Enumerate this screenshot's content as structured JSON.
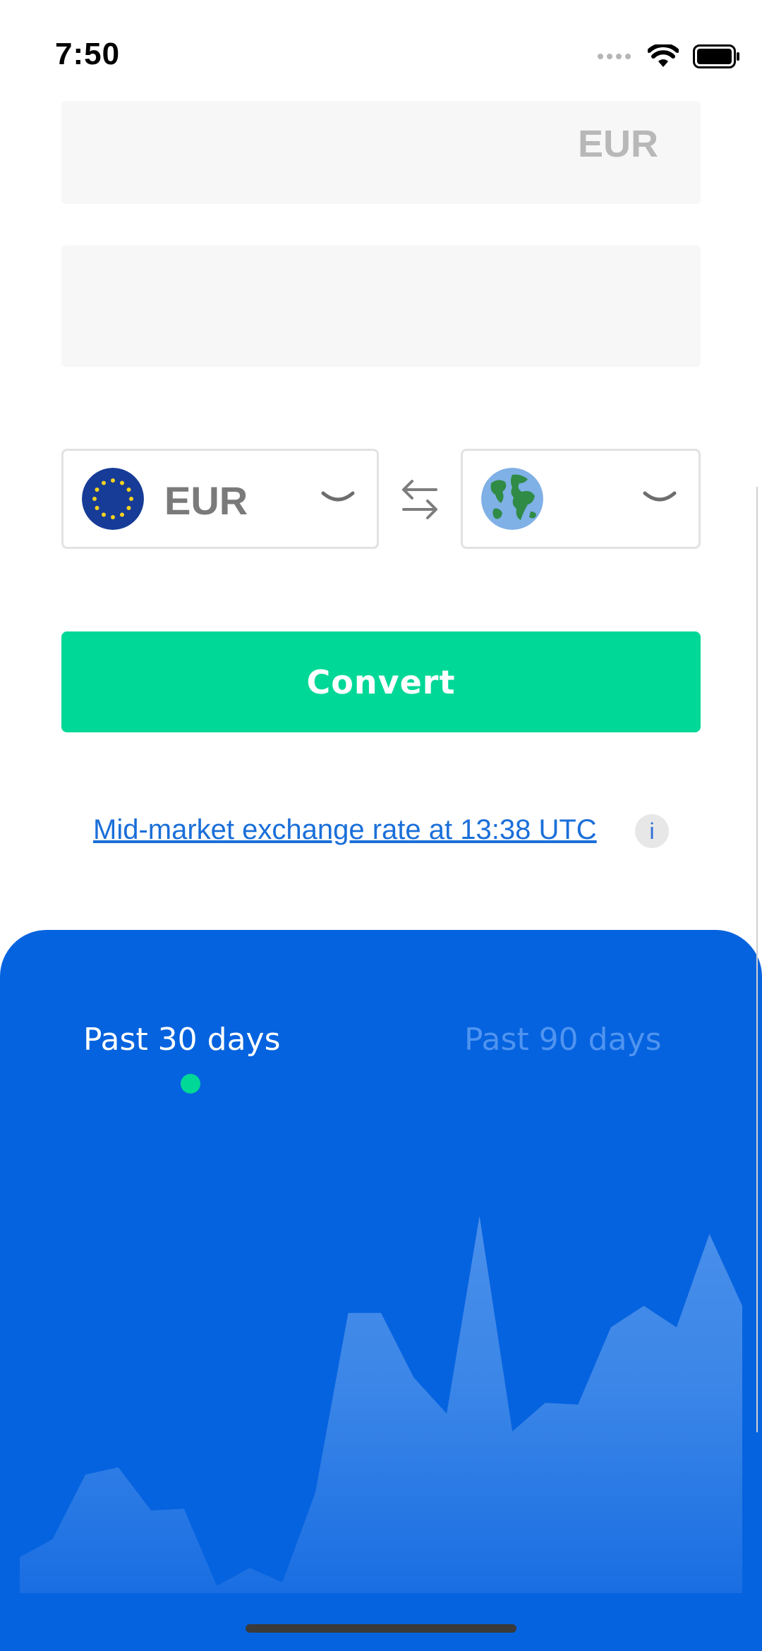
{
  "status_bar": {
    "time": "7:50"
  },
  "converter": {
    "amount_top": {
      "currency": "EUR"
    },
    "from_currency": {
      "code": "EUR",
      "flag_icon": "eu-flag-icon"
    },
    "to_currency": {
      "code": "",
      "flag_icon": "globe-icon"
    },
    "convert_label": "Convert",
    "rate_link": "Mid-market exchange rate at 13:38 UTC",
    "info_label": "i"
  },
  "chart_panel": {
    "tabs": [
      {
        "label": "Past 30 days",
        "active": true
      },
      {
        "label": "Past 90 days",
        "active": false
      }
    ]
  },
  "chart_data": {
    "type": "area",
    "title": "",
    "xlabel": "",
    "ylabel": "",
    "values": [
      1.0,
      1.5,
      3.3,
      3.5,
      2.3,
      2.35,
      0.2,
      0.7,
      0.3,
      2.8,
      7.8,
      7.8,
      6.0,
      5.0,
      10.5,
      4.5,
      5.3,
      5.25,
      7.4,
      8.0,
      7.4,
      10.0,
      8.0
    ],
    "ylim": [
      0,
      11
    ],
    "grid": false,
    "legend": "none"
  },
  "colors": {
    "accent_green": "#00d897",
    "panel_blue": "#0663df",
    "link_blue": "#1a6fd9"
  }
}
